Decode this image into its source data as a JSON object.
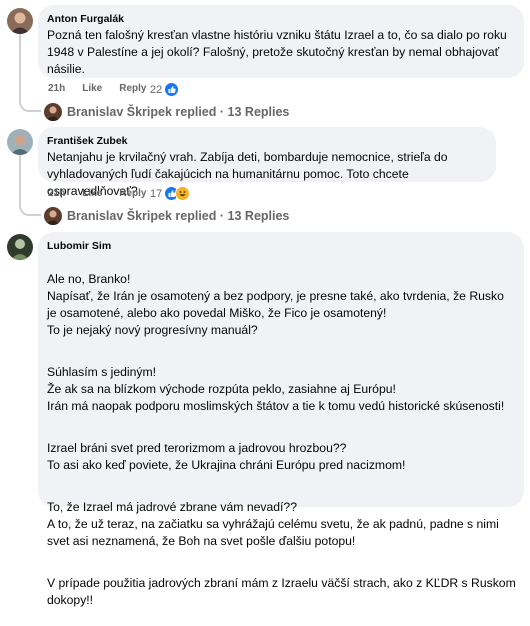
{
  "comments": [
    {
      "author": "Anton Furgalák",
      "text": [
        "Pozná ten falošný kresťan vlastne históriu vzniku štátu Izrael a to, čo sa dialo po roku 1948 v Palestíne a jej okolí? Falošný, pretože skutočný kresťan by nemal obhajovať násilie."
      ],
      "time": "21h",
      "like_label": "Like",
      "reply_label": "Reply",
      "reaction_count": "22",
      "reactions": [
        "like"
      ],
      "replies": {
        "name": "Branislav Škripek",
        "verb": "replied",
        "sep": "·",
        "count": "13 Replies"
      }
    },
    {
      "author": "František Zubek",
      "text": [
        "Netanjahu je krvilačný vrah. Zabíja deti, bombarduje nemocnice, strieľa do vyhladovaných ľudí čakajúcich na humanitárnu pomoc. Toto chcete ospravedlňovať?"
      ],
      "time": "21h",
      "like_label": "Like",
      "reply_label": "Reply",
      "reaction_count": "17",
      "reactions": [
        "like",
        "haha"
      ],
      "replies": {
        "name": "Branislav Škripek",
        "verb": "replied",
        "sep": "·",
        "count": "13 Replies"
      }
    },
    {
      "author": "Lubomir Sim",
      "text": [
        "Ale no, Branko!\nNapísať, že Irán je osamotený a bez podpory, je presne také, ako tvrdenia, že Rusko je osamotené, alebo ako povedal Miško, že Fico je osamotený!\nTo je nejaký nový progresívny manuál?",
        "Súhlasím s jediným!\nŽe ak sa na blízkom východe rozpúta peklo, zasiahne aj Európu!\nIrán má naopak podporu moslimských štátov a tie k tomu vedú historické skúsenosti!",
        "Izrael bráni svet pred terorizmom a jadrovou hrozbou??\nTo asi ako keď poviete, že Ukrajina chráni Európu pred nacizmom!",
        "To, že Izrael má jadrové zbrane vám nevadí??\nA to, že už teraz, na začiatku sa vyhrážajú celému svetu, že ak padnú, padne s nimi svet asi neznamená, že Boh na svet pošle ďalšiu potopu!",
        "V prípade použitia jadrových zbraní mám z Izraelu väčší strach, ako z KĽDR s Ruskom dokopy!!"
      ]
    }
  ],
  "colors": {
    "like": "#1877f2",
    "haha": "#f7b125",
    "bubble": "#f0f2f5",
    "meta": "#65676b"
  }
}
